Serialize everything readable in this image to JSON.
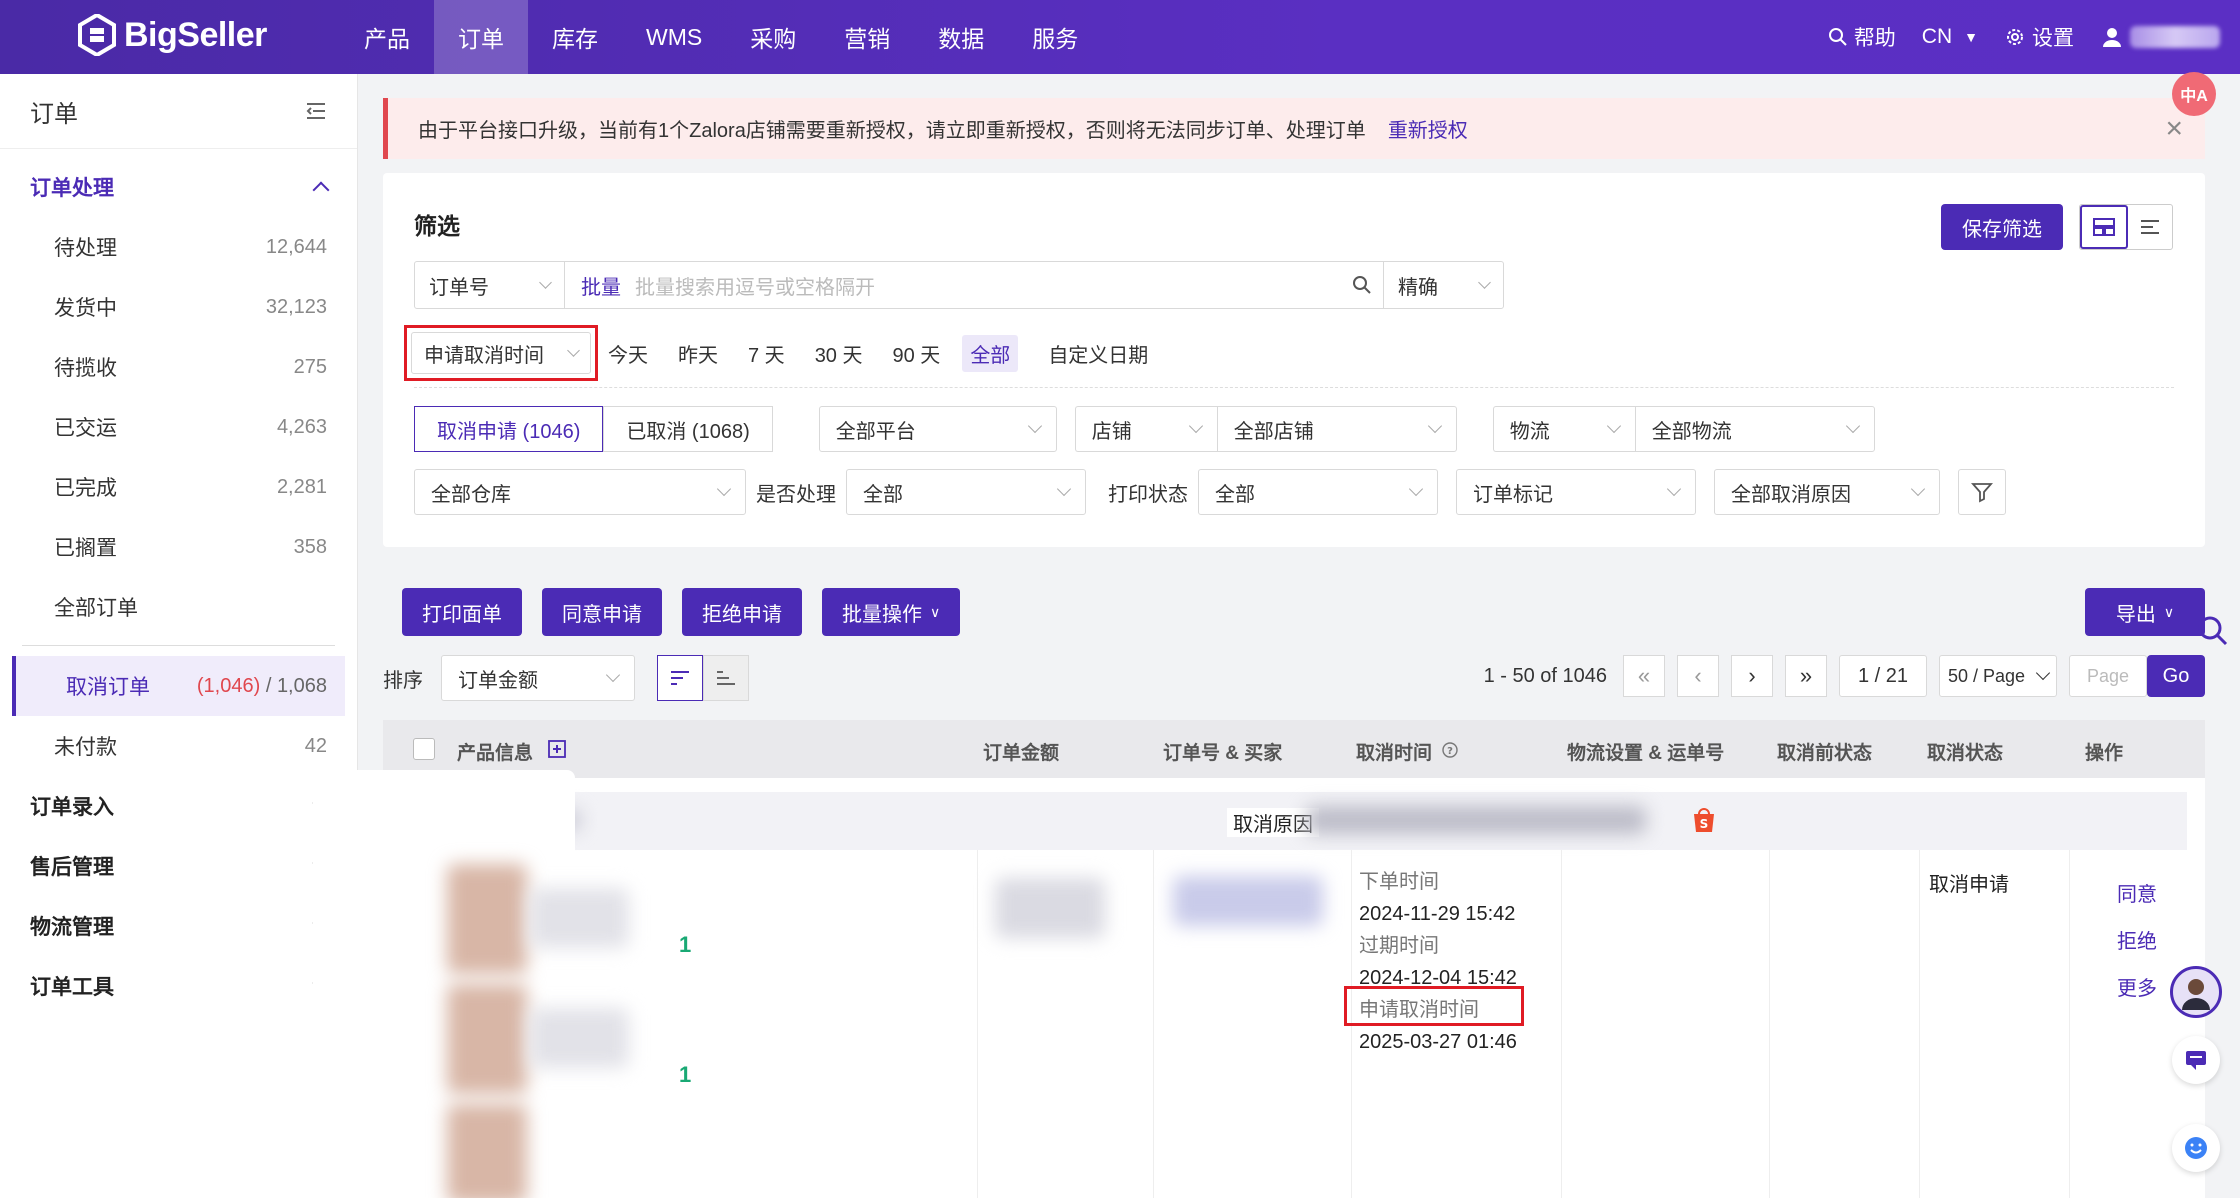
{
  "nav": {
    "brand": "BigSeller",
    "items": [
      "产品",
      "订单",
      "库存",
      "WMS",
      "采购",
      "营销",
      "数据",
      "服务"
    ],
    "help": "帮助",
    "lang": "CN",
    "settings": "设置"
  },
  "sidebar": {
    "title": "订单",
    "group_processing": "订单处理",
    "items": [
      {
        "label": "待处理",
        "count": "12,644"
      },
      {
        "label": "发货中",
        "count": "32,123"
      },
      {
        "label": "待揽收",
        "count": "275"
      },
      {
        "label": "已交运",
        "count": "4,263"
      },
      {
        "label": "已完成",
        "count": "2,281"
      },
      {
        "label": "已搁置",
        "count": "358"
      },
      {
        "label": "全部订单",
        "count": ""
      }
    ],
    "cancel": {
      "label": "取消订单",
      "count_red": "(1,046)",
      "sep": " / ",
      "count_total": "1,068"
    },
    "unpaid": {
      "label": "未付款",
      "count": "42"
    },
    "groups": [
      "订单录入",
      "售后管理",
      "物流管理",
      "订单工具"
    ]
  },
  "alert": {
    "text": "由于平台接口升级，当前有1个Zalora店铺需要重新授权，请立即重新授权，否则将无法同步订单、处理订单",
    "link": "重新授权",
    "close": "×"
  },
  "filter": {
    "title": "筛选",
    "save": "保存筛选",
    "search_type": "订单号",
    "bulk": "批量",
    "search_placeholder": "批量搜索用逗号或空格隔开",
    "match": "精确",
    "time_field": "申请取消时间",
    "time_options": [
      "今天",
      "昨天",
      "7 天",
      "30 天",
      "90 天"
    ],
    "time_all": "全部",
    "time_custom": "自定义日期",
    "seg_cancel_req": "取消申请 (1046)",
    "seg_cancelled": "已取消 (1068)",
    "platform": "全部平台",
    "shop_label": "店铺",
    "shop_all": "全部店铺",
    "logistics_label": "物流",
    "logistics_all": "全部物流",
    "warehouse": "全部仓库",
    "processed_label": "是否处理",
    "processed_all": "全部",
    "print_label": "打印状态",
    "print_all": "全部",
    "order_mark": "订单标记",
    "cancel_reason": "全部取消原因"
  },
  "actions": {
    "print": "打印面单",
    "agree": "同意申请",
    "reject": "拒绝申请",
    "batch": "批量操作",
    "export": "导出"
  },
  "sort": {
    "label": "排序",
    "field": "订单金额"
  },
  "pagination": {
    "range": "1 - 50 of 1046",
    "page": "1 / 21",
    "per_page": "50 / Page",
    "page_placeholder": "Page",
    "go": "Go"
  },
  "table": {
    "headers": [
      "产品信息",
      "订单金额",
      "订单号 & 买家",
      "取消时间",
      "物流设置 & 运单号",
      "取消前状态",
      "取消状态",
      "操作"
    ],
    "cancel_reason_label": "取消原因",
    "row": {
      "qty1": "1",
      "qty2": "1",
      "order_time_label": "下单时间",
      "order_time": "2024-11-29 15:42",
      "expire_label": "过期时间",
      "expire_time": "2024-12-04 15:42",
      "apply_label": "申请取消时间",
      "apply_time": "2025-03-27 01:46",
      "status": "取消申请",
      "op_agree": "同意",
      "op_reject": "拒绝",
      "op_more": "更多"
    }
  },
  "colors": {
    "brand": "#4b2bb5",
    "alert": "#e0474e",
    "highlight": "#e01b24"
  }
}
